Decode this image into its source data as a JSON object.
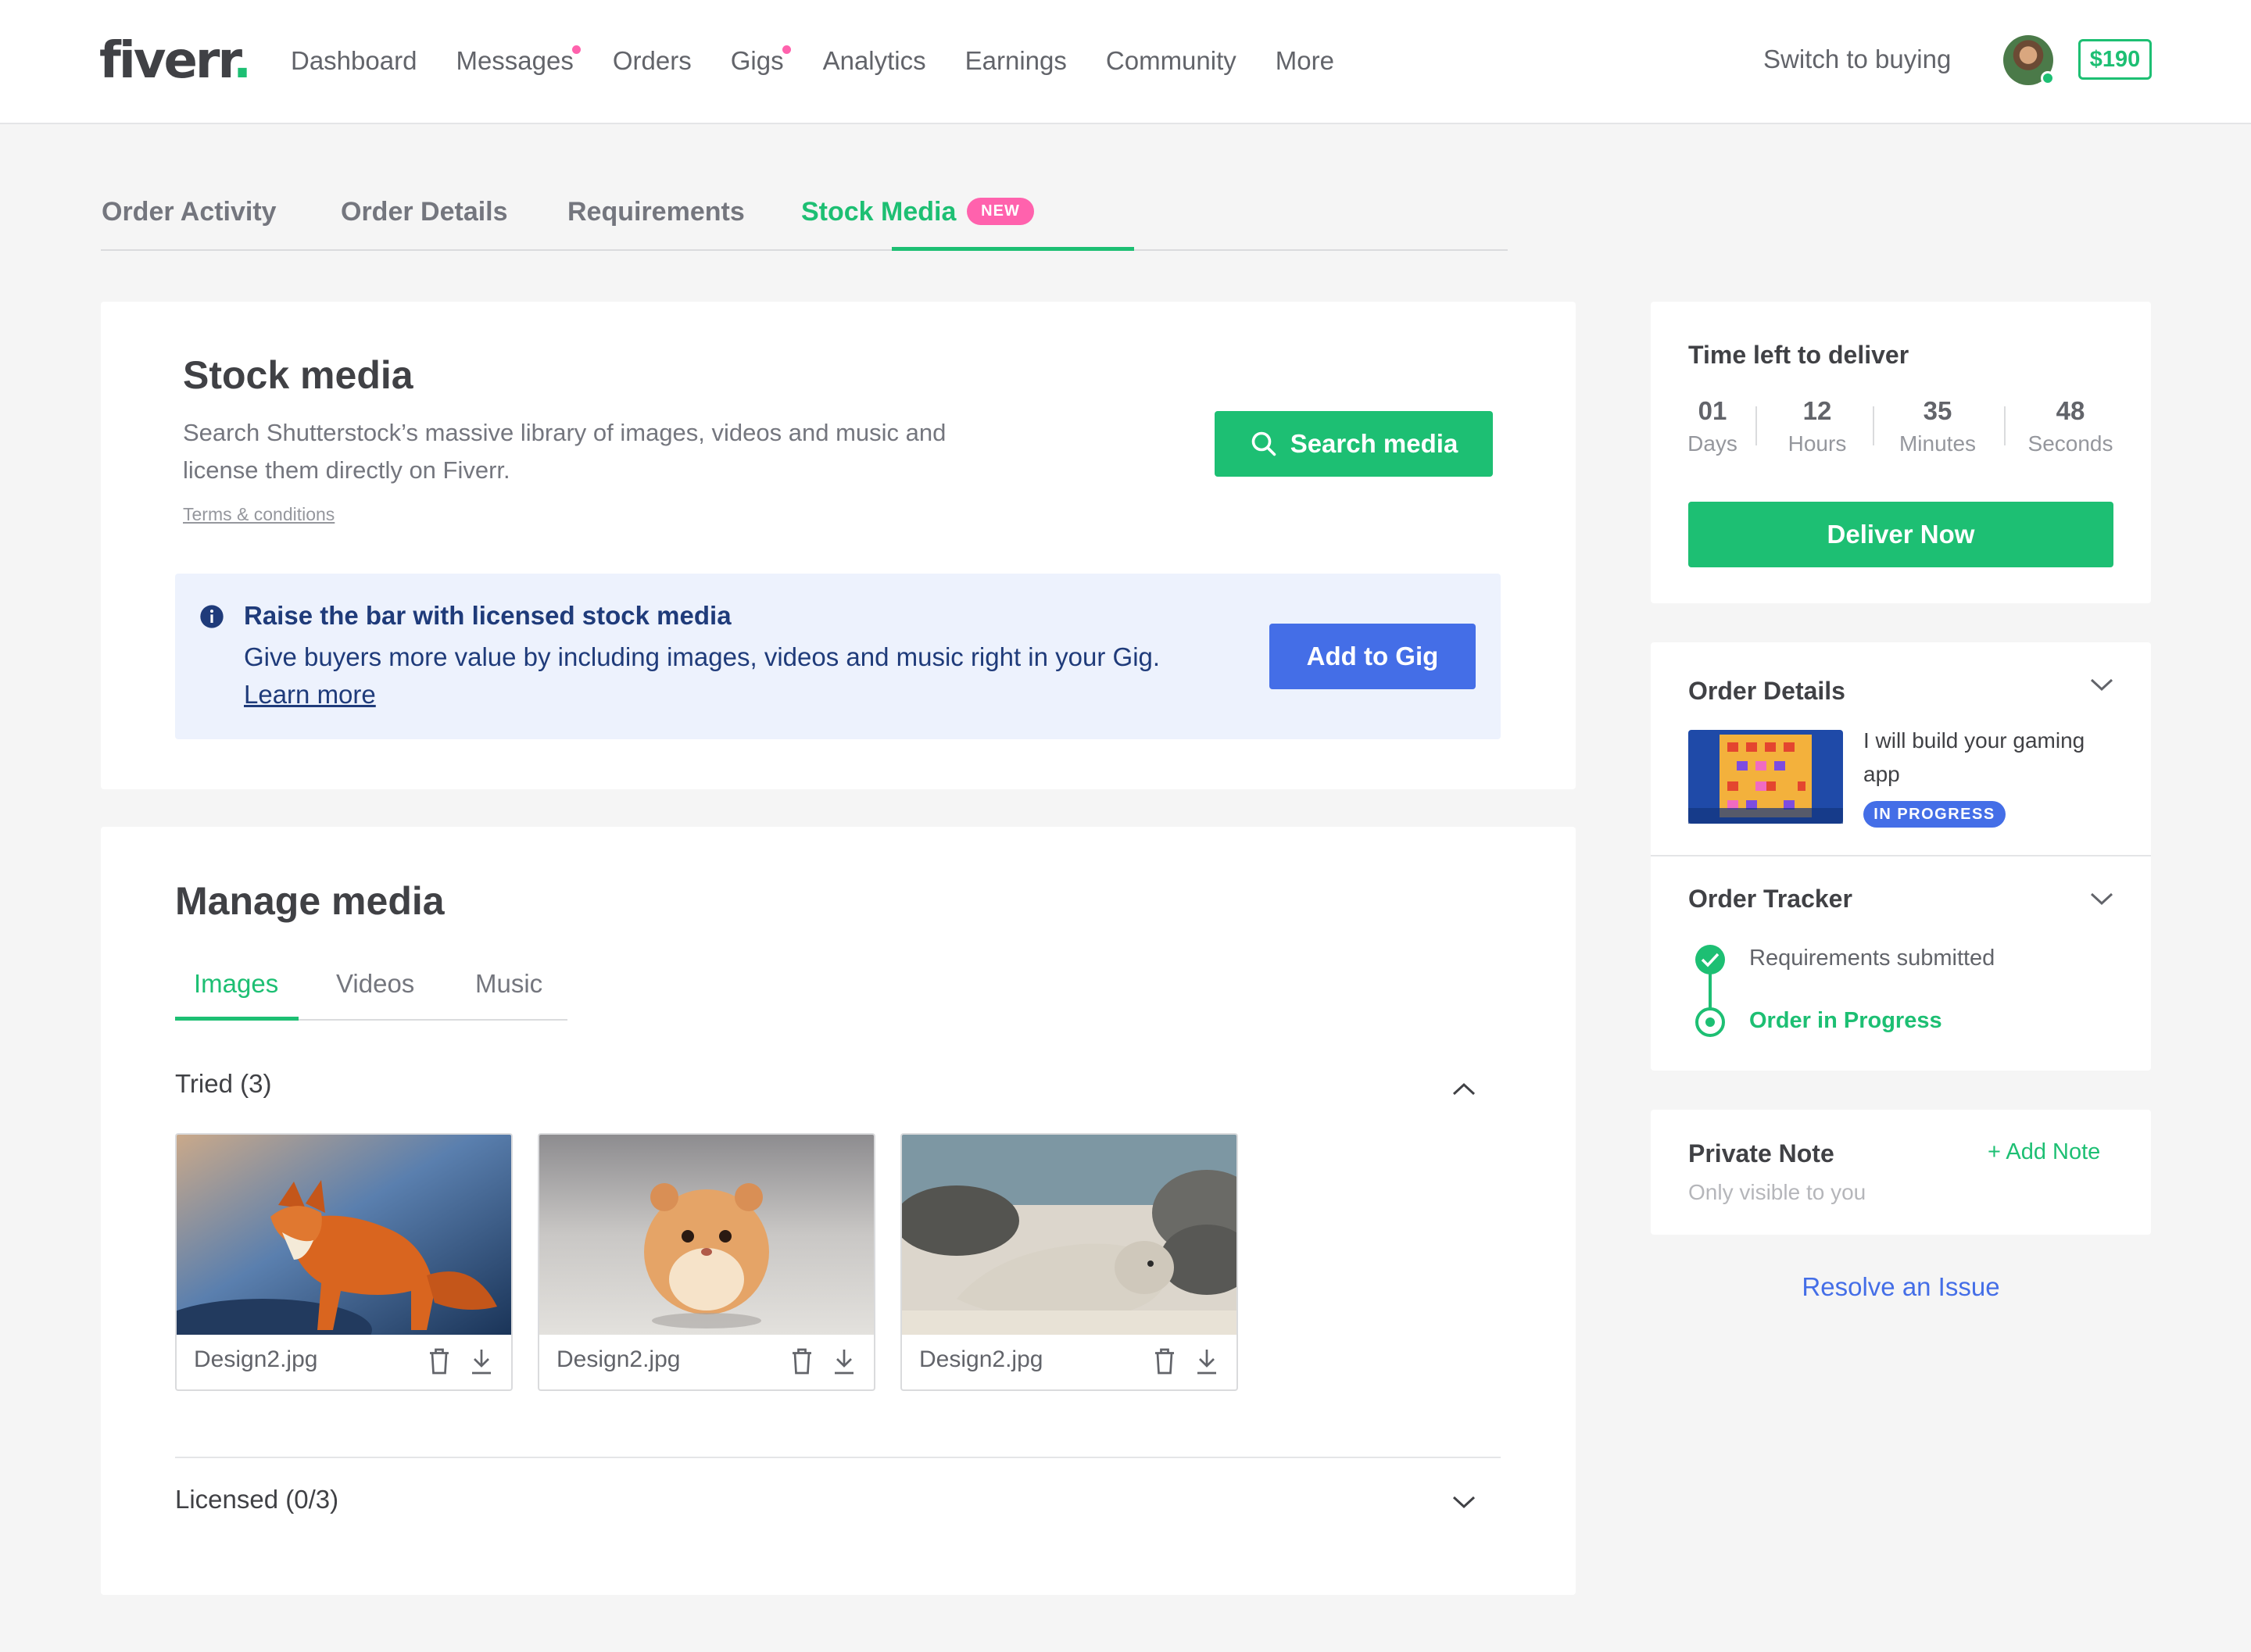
{
  "header": {
    "logo_text": "fiverr",
    "logo_dot": ".",
    "nav": [
      {
        "label": "Dashboard",
        "notify": false
      },
      {
        "label": "Messages",
        "notify": true
      },
      {
        "label": "Orders",
        "notify": false
      },
      {
        "label": "Gigs",
        "notify": true
      },
      {
        "label": "Analytics",
        "notify": false
      },
      {
        "label": "Earnings",
        "notify": false
      },
      {
        "label": "Community",
        "notify": false
      },
      {
        "label": "More",
        "notify": false
      }
    ],
    "switch_label": "Switch to buying",
    "balance": "$190"
  },
  "tabs": {
    "items": [
      "Order Activity",
      "Order Details",
      "Requirements",
      "Stock Media"
    ],
    "active": "Stock Media",
    "new_badge": "NEW"
  },
  "stock": {
    "title": "Stock media",
    "description_line1": "Search Shutterstock’s massive library of images, videos and music and",
    "description_line2": "license them directly on Fiverr.",
    "terms": "Terms & conditions",
    "search_button": "Search media",
    "info_title": "Raise the bar with licensed stock media",
    "info_body": "Give buyers more value by including images, videos and music right in your Gig.",
    "info_link": "Learn more",
    "add_button": "Add to Gig"
  },
  "manage": {
    "title": "Manage media",
    "tabs": [
      "Images",
      "Videos",
      "Music"
    ],
    "active_tab": "Images",
    "tried_label": "Tried (3)",
    "files": [
      {
        "name": "Design2.jpg",
        "subject": "fox"
      },
      {
        "name": "Design2.jpg",
        "subject": "hamster"
      },
      {
        "name": "Design2.jpg",
        "subject": "seal"
      }
    ],
    "licensed_label": "Licensed (0/3)"
  },
  "sidebar": {
    "time_title": "Time left to deliver",
    "countdown": [
      {
        "value": "01",
        "unit": "Days"
      },
      {
        "value": "12",
        "unit": "Hours"
      },
      {
        "value": "35",
        "unit": "Minutes"
      },
      {
        "value": "48",
        "unit": "Seconds"
      }
    ],
    "deliver_button": "Deliver Now",
    "order_details_title": "Order Details",
    "gig_title_line1": "I will build your gaming",
    "gig_title_line2": "app",
    "status": "IN PROGRESS",
    "tracker_title": "Order Tracker",
    "tracker_steps": [
      "Requirements submitted",
      "Order in Progress"
    ],
    "note_title": "Private Note",
    "note_sub": "Only visible to you",
    "add_note": "+ Add Note",
    "resolve": "Resolve an Issue"
  },
  "colors": {
    "brand_green": "#1dbf73",
    "blue": "#446ee7",
    "pink": "#ff62ad",
    "info_bg": "#edf2fd"
  }
}
